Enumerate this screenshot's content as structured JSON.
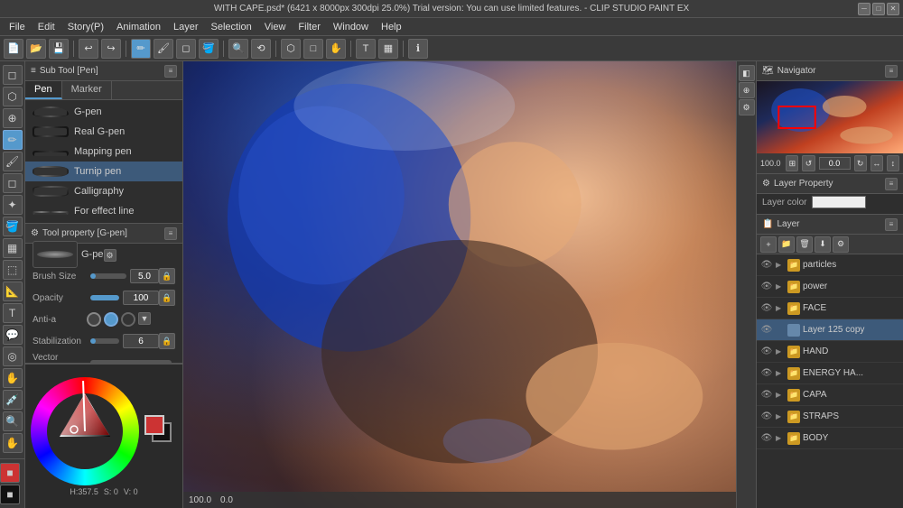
{
  "title_bar": {
    "text": "WITH CAPE.psd* (6421 x 8000px 300dpi 25.0%)  Trial version: You can use limited features. - CLIP STUDIO PAINT EX"
  },
  "menu": {
    "items": [
      "File",
      "Edit",
      "Story(P)",
      "Animation",
      "Layer",
      "Selection",
      "View",
      "Filter",
      "Window",
      "Help"
    ]
  },
  "sub_tool_panel": {
    "header": "Sub Tool [Pen]",
    "tabs": [
      {
        "label": "Pen",
        "active": true
      },
      {
        "label": "Marker",
        "active": false
      }
    ],
    "brushes": [
      {
        "name": "G-pen",
        "active": false
      },
      {
        "name": "Real G-pen",
        "active": false
      },
      {
        "name": "Mapping pen",
        "active": false
      },
      {
        "name": "Turnip pen",
        "active": false
      },
      {
        "name": "Calligraphy",
        "active": false
      },
      {
        "name": "For effect line",
        "active": false
      }
    ]
  },
  "tool_property": {
    "header": "Tool property [G-pen]",
    "brush_name": "G-pen",
    "brush_size_label": "Brush Size",
    "brush_size_value": "5.0",
    "opacity_label": "Opacity",
    "opacity_value": "100",
    "anti_aliasing_label": "Anti-a",
    "stabilization_label": "Stabilization",
    "stabilization_value": "6",
    "vector_magnet_label": "Vector magnet"
  },
  "color_area": {
    "hue_label": "H:357.5",
    "s_label": "S: 0",
    "v_label": "V: 0"
  },
  "canvas": {
    "zoom_label": "100.0",
    "coords_label": "0.0"
  },
  "navigator": {
    "header": "Navigator",
    "zoom_value": "100.0",
    "rotation_value": "0.0"
  },
  "layer_property": {
    "header": "Layer Property",
    "layer_color_label": "Layer color"
  },
  "layer_list": {
    "header": "Layer",
    "layers": [
      {
        "name": "particles",
        "type": "folder",
        "visible": true,
        "active": false
      },
      {
        "name": "power",
        "type": "folder",
        "visible": true,
        "active": false
      },
      {
        "name": "FACE",
        "type": "folder",
        "visible": true,
        "active": false
      },
      {
        "name": "Layer 125 copy",
        "type": "layer",
        "visible": true,
        "active": true
      },
      {
        "name": "HAND",
        "type": "folder",
        "visible": true,
        "active": false
      },
      {
        "name": "ENERGY HA...",
        "type": "folder",
        "visible": true,
        "active": false
      },
      {
        "name": "CAPA",
        "type": "folder",
        "visible": true,
        "active": false
      },
      {
        "name": "STRAPS",
        "type": "folder",
        "visible": true,
        "active": false
      },
      {
        "name": "BODY",
        "type": "folder",
        "visible": true,
        "active": false
      }
    ]
  },
  "tools": {
    "left": [
      "✦",
      "⬚",
      "□",
      "⊕",
      "✏",
      "⬛",
      "⬜",
      "✂",
      "⟲",
      "🔍",
      "🔼",
      "⬡",
      "◎",
      "✋",
      "↩",
      "▦",
      "🪣",
      "⬡",
      "◻",
      "■",
      "◻",
      "■"
    ]
  }
}
